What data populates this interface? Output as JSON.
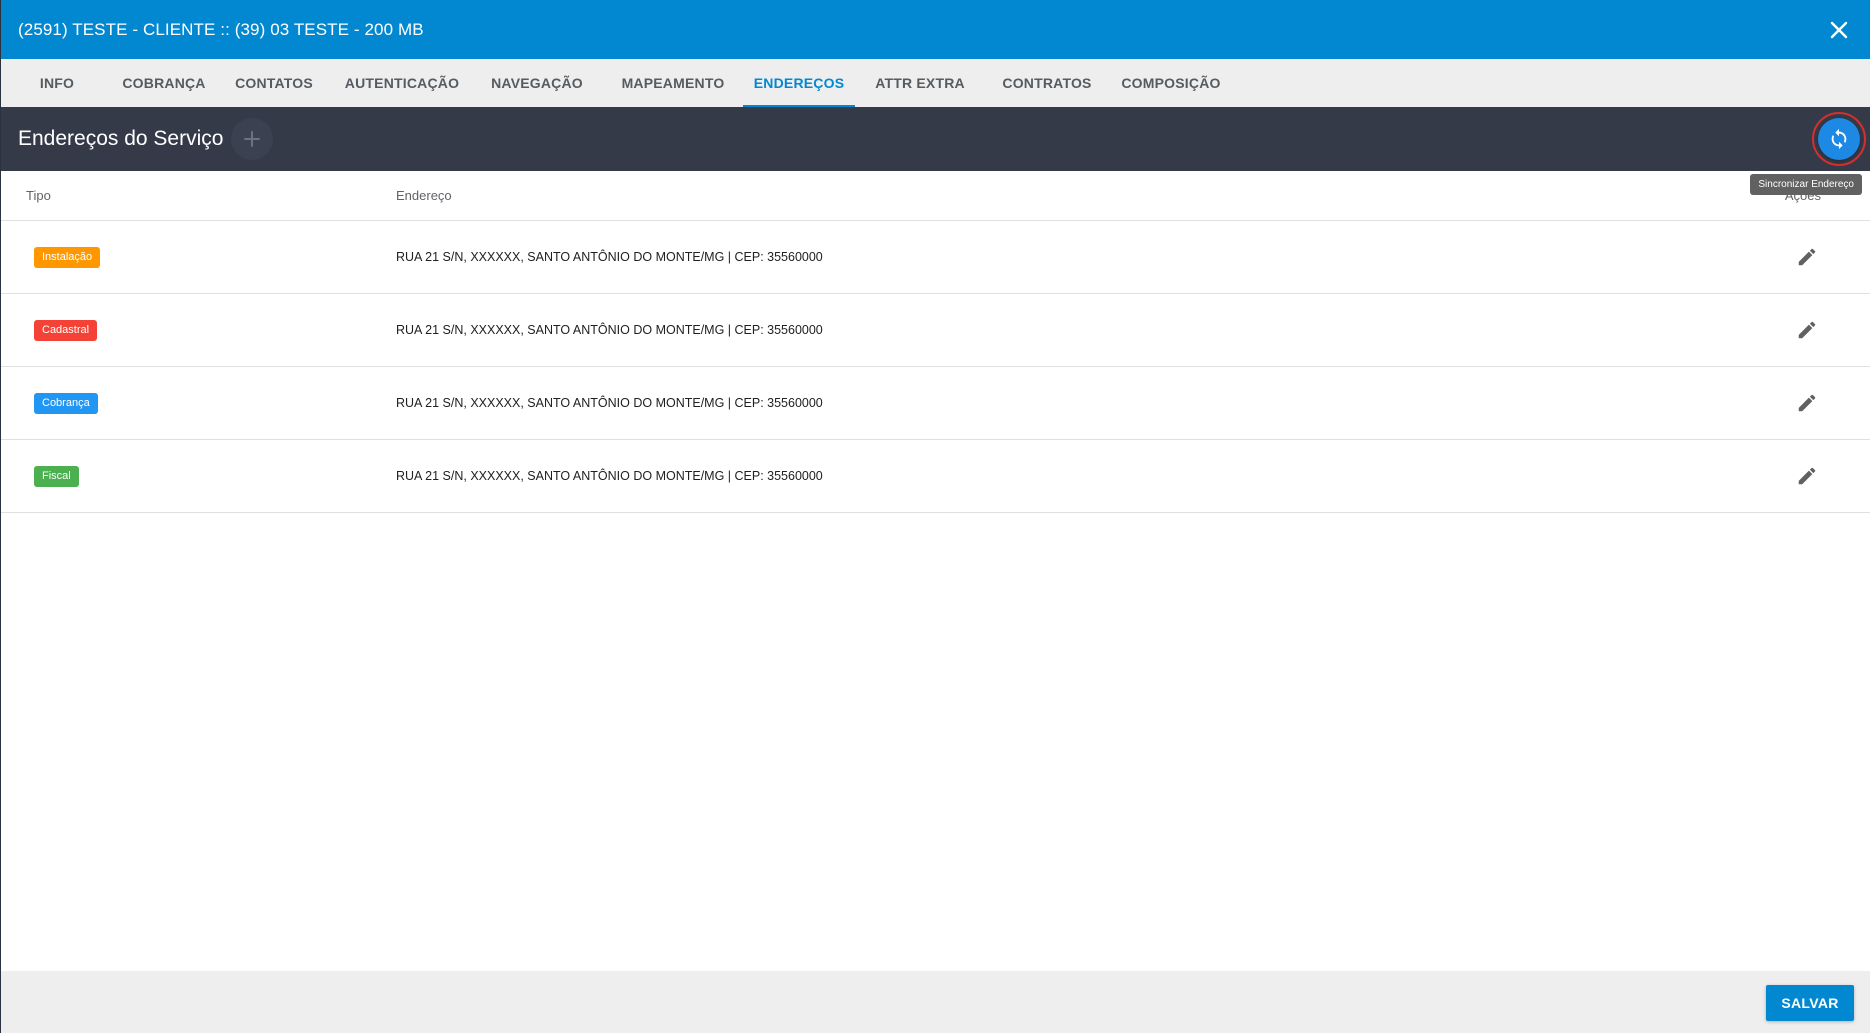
{
  "header": {
    "title": "(2591) TESTE - CLIENTE :: (39) 03 TESTE - 200 MB",
    "close_icon": "close-icon"
  },
  "tabs": [
    {
      "label": "INFO",
      "active": false
    },
    {
      "label": "COBRANÇA",
      "active": false
    },
    {
      "label": "CONTATOS",
      "active": false
    },
    {
      "label": "AUTENTICAÇÃO",
      "active": false
    },
    {
      "label": "NAVEGAÇÃO",
      "active": false
    },
    {
      "label": "MAPEAMENTO",
      "active": false
    },
    {
      "label": "ENDEREÇOS",
      "active": true
    },
    {
      "label": "ATTR EXTRA",
      "active": false
    },
    {
      "label": "CONTRATOS",
      "active": false
    },
    {
      "label": "COMPOSIÇÃO",
      "active": false
    }
  ],
  "section": {
    "title": "Endereços do Serviço",
    "add_icon": "plus-icon",
    "sync_icon": "sync-icon",
    "sync_tooltip": "Sincronizar Endereço"
  },
  "table": {
    "headers": {
      "tipo": "Tipo",
      "endereco": "Endereço",
      "acoes": "Ações"
    },
    "rows": [
      {
        "tipo": "Instalação",
        "color": "#ff9800",
        "endereco": "RUA 21 S/N, XXXXXX, SANTO ANTÔNIO DO MONTE/MG | CEP: 35560000"
      },
      {
        "tipo": "Cadastral",
        "color": "#f44336",
        "endereco": "RUA 21 S/N, XXXXXX, SANTO ANTÔNIO DO MONTE/MG | CEP: 35560000"
      },
      {
        "tipo": "Cobrança",
        "color": "#2196f3",
        "endereco": "RUA 21 S/N, XXXXXX, SANTO ANTÔNIO DO MONTE/MG | CEP: 35560000"
      },
      {
        "tipo": "Fiscal",
        "color": "#4caf50",
        "endereco": "RUA 21 S/N, XXXXXX, SANTO ANTÔNIO DO MONTE/MG | CEP: 35560000"
      }
    ]
  },
  "footer": {
    "save_label": "SALVAR"
  },
  "colors": {
    "primary": "#0288d1",
    "toolbar": "#343a48",
    "sync_button": "#1e88e5",
    "highlight_ring": "#d32f2f"
  }
}
